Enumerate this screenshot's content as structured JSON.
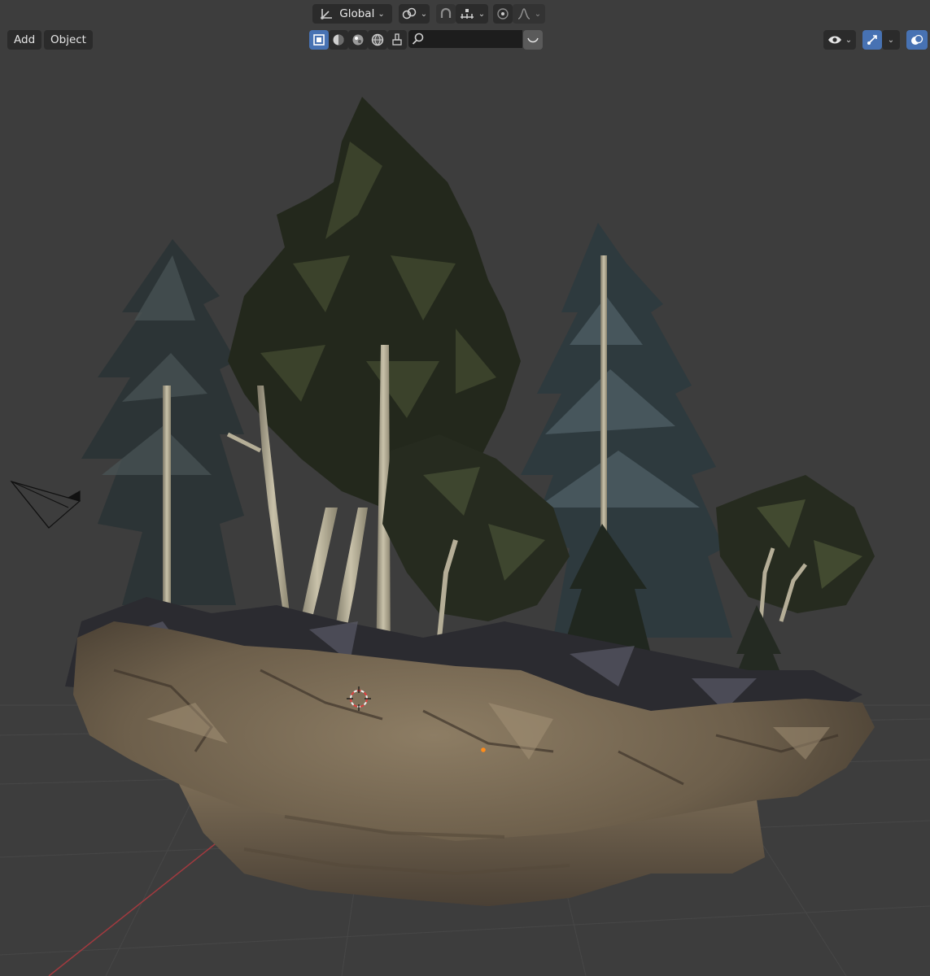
{
  "header": {
    "transform_orientation": "Global",
    "menus": [
      {
        "label": "Add"
      },
      {
        "label": "Object"
      }
    ]
  },
  "icons": {
    "orientation": "axes-icon",
    "pivot": "link-pivot-icon",
    "snap": "magnet-icon",
    "snap_target": "snap-increment-icon",
    "proportional": "proportional-edit-icon",
    "falloff": "falloff-curve-icon",
    "shading": [
      "solid-shading-icon",
      "material-preview-icon",
      "rendered-shading-icon",
      "world-icon"
    ],
    "search": "search-icon",
    "visibility": "eye-icon",
    "gizmo": "gizmo-icon",
    "overlays": "overlays-icon"
  },
  "search": {
    "placeholder": ""
  },
  "colors": {
    "active": "#4772b3",
    "viewport_bg": "#3d3d3d",
    "button_bg": "#2b2b2b",
    "x_axis": "#a33a3f",
    "grid": "#474747"
  }
}
